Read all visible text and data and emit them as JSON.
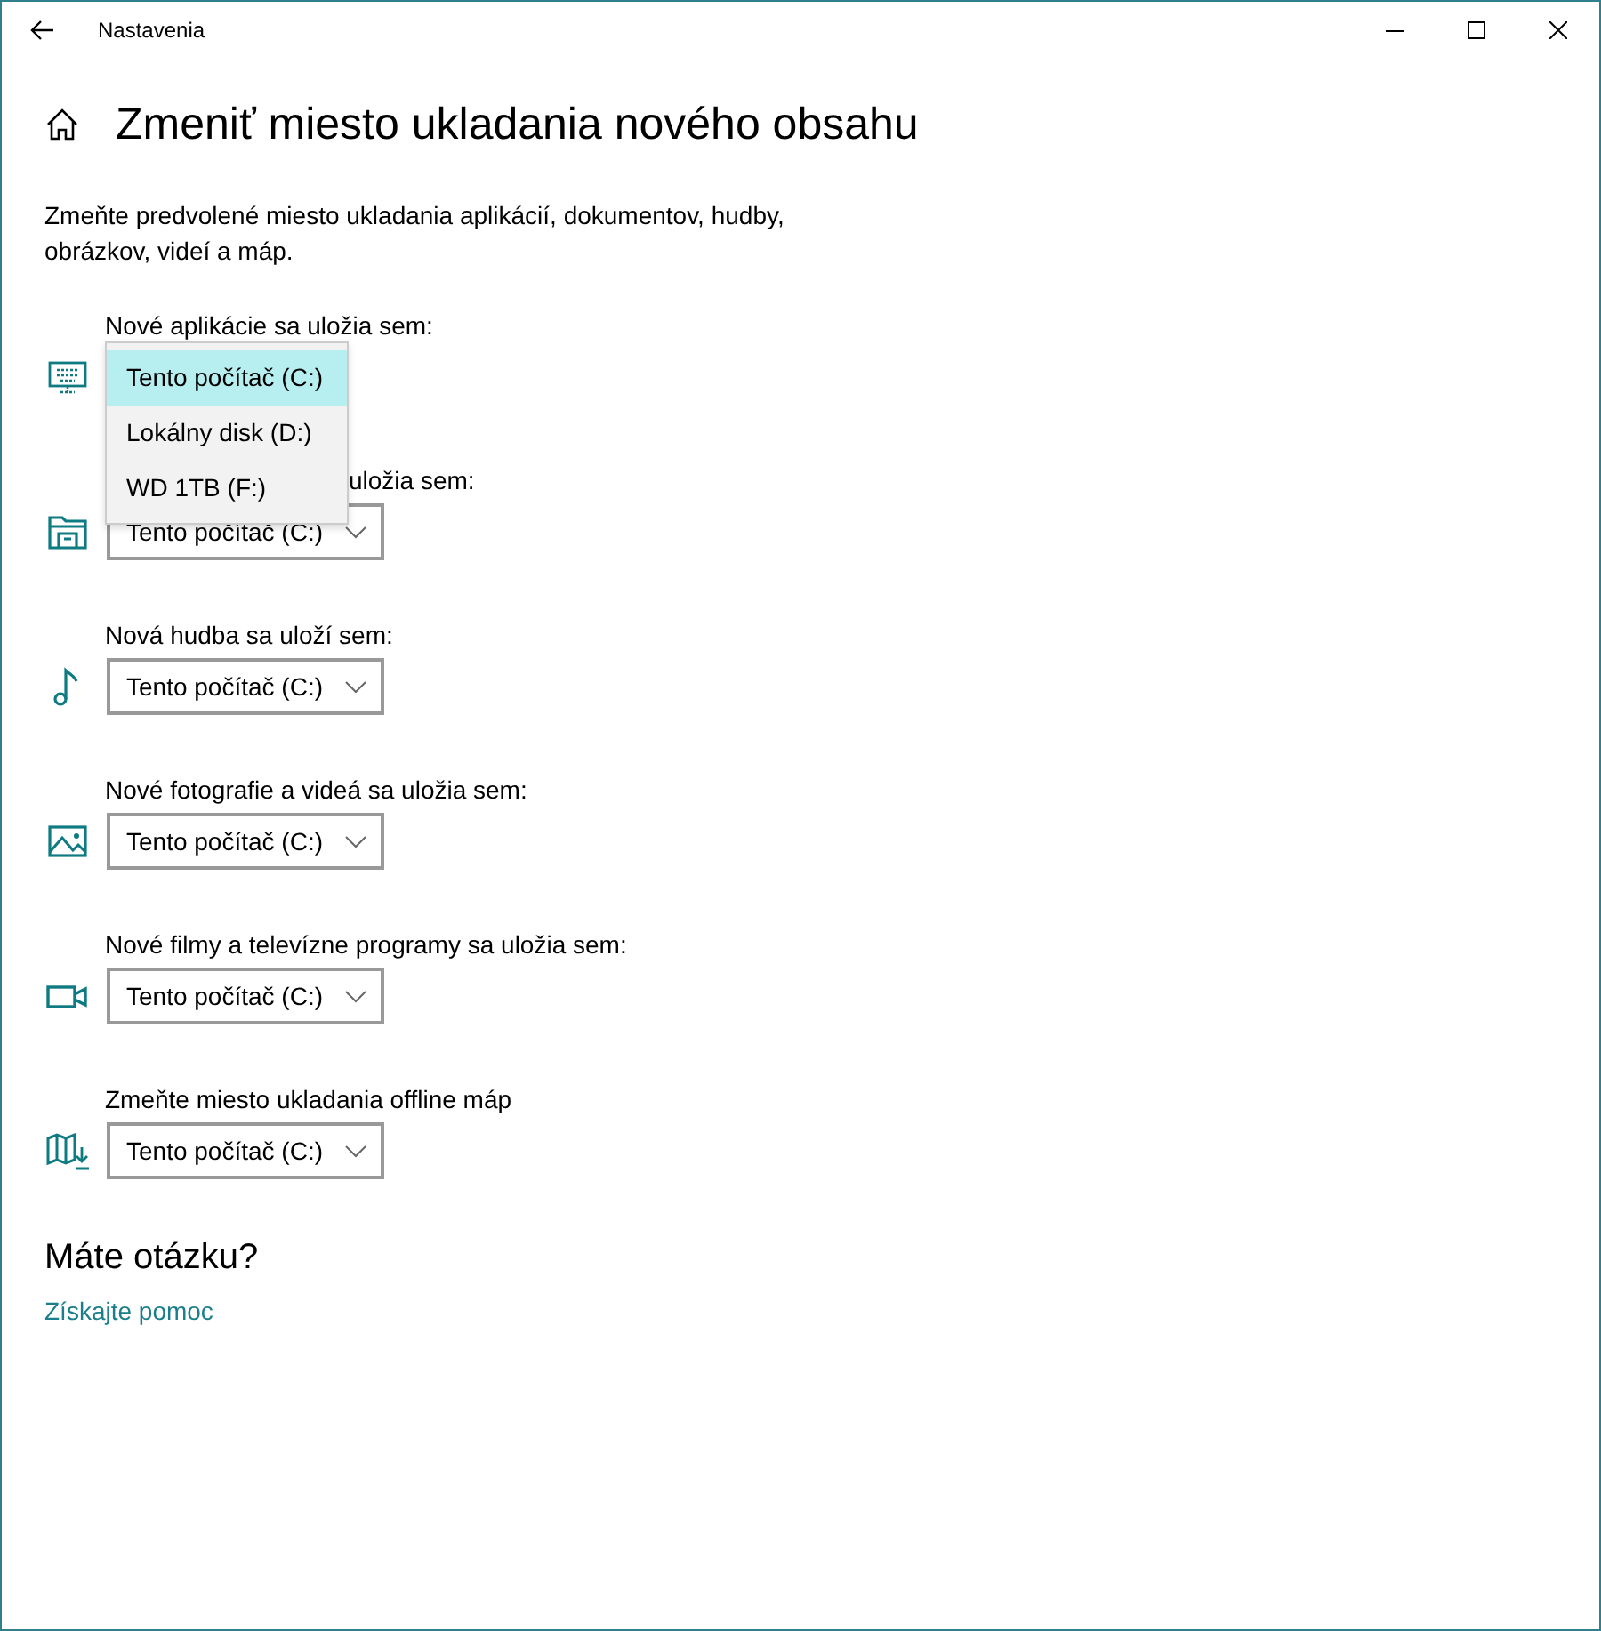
{
  "window": {
    "title": "Nastavenia"
  },
  "page": {
    "title": "Zmeniť miesto ukladania nového obsahu",
    "description": "Zmeňte predvolené miesto ukladania aplikácií, dokumentov, hudby, obrázkov, videí a máp."
  },
  "sections": [
    {
      "label": "Nové aplikácie sa uložia sem:",
      "options": [
        {
          "label": "Tento počítač (C:)",
          "selected": true
        },
        {
          "label": "Lokálny disk (D:)",
          "selected": false
        },
        {
          "label": "WD 1TB (F:)",
          "selected": false
        }
      ]
    },
    {
      "label": "uložia sem:",
      "value": "Tento počítač (C:)"
    },
    {
      "label": "Nová hudba sa uloží sem:",
      "value": "Tento počítač (C:)"
    },
    {
      "label": "Nové fotografie a videá sa uložia sem:",
      "value": "Tento počítač (C:)"
    },
    {
      "label": "Nové filmy a televízne programy sa uložia sem:",
      "value": "Tento počítač (C:)"
    },
    {
      "label": "Zmeňte miesto ukladania offline máp",
      "value": "Tento počítač (C:)"
    }
  ],
  "help": {
    "title": "Máte otázku?",
    "link": "Získajte pomoc"
  }
}
